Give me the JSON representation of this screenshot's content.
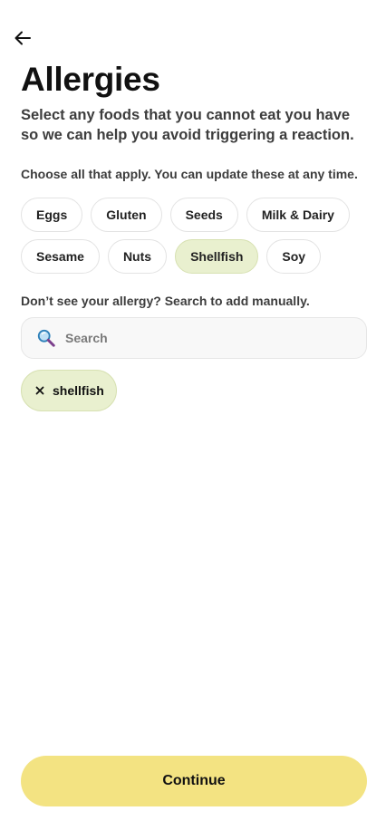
{
  "header": {
    "back_icon": "arrow-left-icon",
    "title": "Allergies",
    "subtitle": "Select any foods that you cannot eat you have so we can help you avoid triggering a reaction."
  },
  "allergens": {
    "instruction": "Choose all that apply. You can update these at any time.",
    "options": [
      {
        "label": "Eggs",
        "selected": false
      },
      {
        "label": "Gluten",
        "selected": false
      },
      {
        "label": "Seeds",
        "selected": false
      },
      {
        "label": "Milk & Dairy",
        "selected": false
      },
      {
        "label": "Sesame",
        "selected": false
      },
      {
        "label": "Nuts",
        "selected": false
      },
      {
        "label": "Shellfish",
        "selected": true
      },
      {
        "label": "Soy",
        "selected": false
      }
    ]
  },
  "manual": {
    "label": "Don’t see your allergy? Search to add manually.",
    "search": {
      "icon": "magnifying-glass-icon",
      "placeholder": "Search",
      "value": ""
    },
    "added": [
      {
        "label": "shellfish",
        "remove_icon": "close-icon"
      }
    ]
  },
  "footer": {
    "continue_label": "Continue"
  },
  "colors": {
    "selected_chip": "#e9f0cf",
    "primary_button": "#f3e382",
    "text_muted": "#3d3d3d"
  }
}
